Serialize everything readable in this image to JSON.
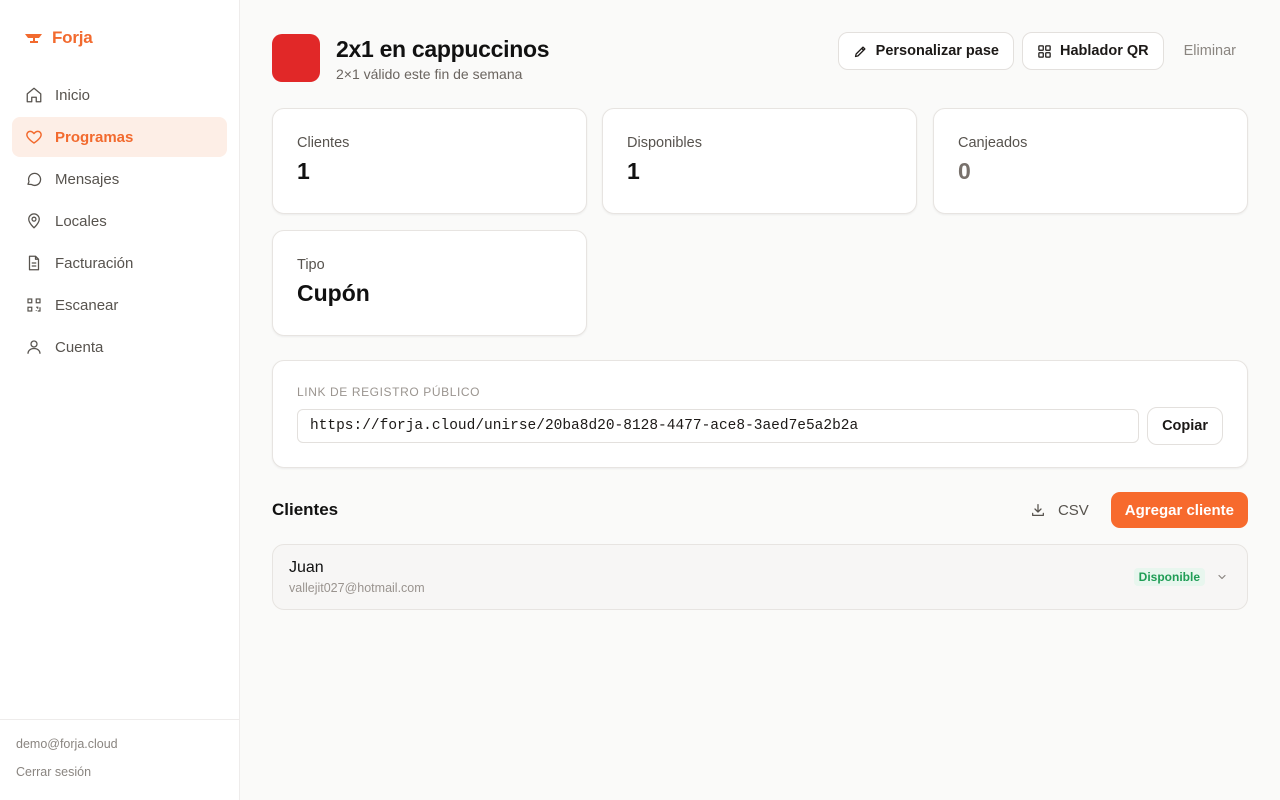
{
  "brand": {
    "name": "Forja"
  },
  "sidebar": {
    "items": [
      {
        "label": "Inicio",
        "icon": "home-icon"
      },
      {
        "label": "Programas",
        "icon": "heart-icon",
        "active": true
      },
      {
        "label": "Mensajes",
        "icon": "chat-bubble-icon"
      },
      {
        "label": "Locales",
        "icon": "map-pin-icon"
      },
      {
        "label": "Facturación",
        "icon": "document-icon"
      },
      {
        "label": "Escanear",
        "icon": "scan-icon"
      },
      {
        "label": "Cuenta",
        "icon": "user-icon"
      }
    ],
    "user_email": "demo@forja.cloud",
    "logout_label": "Cerrar sesión"
  },
  "program": {
    "title": "2x1 en cappuccinos",
    "subtitle": "2×1 válido este fin de semana",
    "color": "#e12828"
  },
  "header_actions": {
    "customize_label": "Personalizar pase",
    "qr_label": "Hablador QR",
    "delete_label": "Eliminar"
  },
  "stats": [
    {
      "label": "Clientes",
      "value": "1"
    },
    {
      "label": "Disponibles",
      "value": "1"
    },
    {
      "label": "Canjeados",
      "value": "0"
    },
    {
      "label": "Tipo",
      "value": "Cupón"
    }
  ],
  "registration": {
    "label": "LINK DE REGISTRO PÚBLICO",
    "url": "https://forja.cloud/unirse/20ba8d20-8128-4477-ace8-3aed7e5a2b2a",
    "copy_label": "Copiar"
  },
  "clients": {
    "title": "Clientes",
    "csv_label": "CSV",
    "add_label": "Agregar cliente",
    "rows": [
      {
        "name": "Juan",
        "email": "vallejit027@hotmail.com",
        "status": "Disponible"
      }
    ]
  },
  "colors": {
    "accent": "#f26a2e",
    "accent_button": "#f76a2d",
    "status_green": "#1f9d55"
  }
}
